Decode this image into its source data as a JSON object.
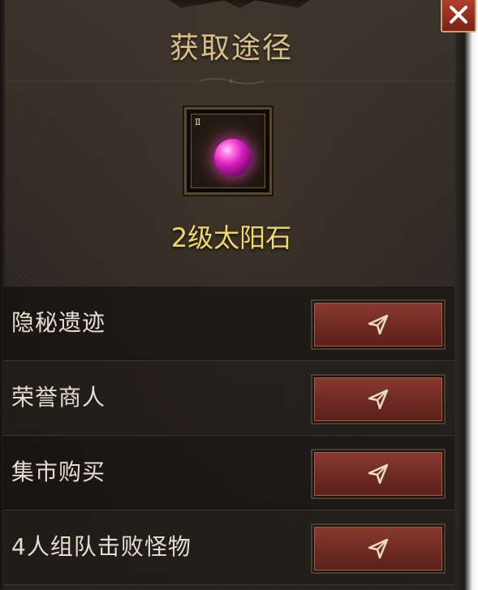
{
  "dialog": {
    "title": "获取途径",
    "close_icon": "close-icon"
  },
  "item": {
    "name": "2级太阳石",
    "icon": "purple-gem-icon",
    "badge_icon": "level-badge-icon",
    "gem_color": "#d11ab8"
  },
  "sources": [
    {
      "label": "隐秘遗迹",
      "action_icon": "navigate-arrow-icon"
    },
    {
      "label": "荣誉商人",
      "action_icon": "navigate-arrow-icon"
    },
    {
      "label": "集市购买",
      "action_icon": "navigate-arrow-icon"
    },
    {
      "label": "4人组队击败怪物",
      "action_icon": "navigate-arrow-icon"
    }
  ],
  "colors": {
    "title": "#dbbf8a",
    "item_name": "#f2d76a",
    "button": "#7c2d24",
    "close_button": "#a23526"
  }
}
